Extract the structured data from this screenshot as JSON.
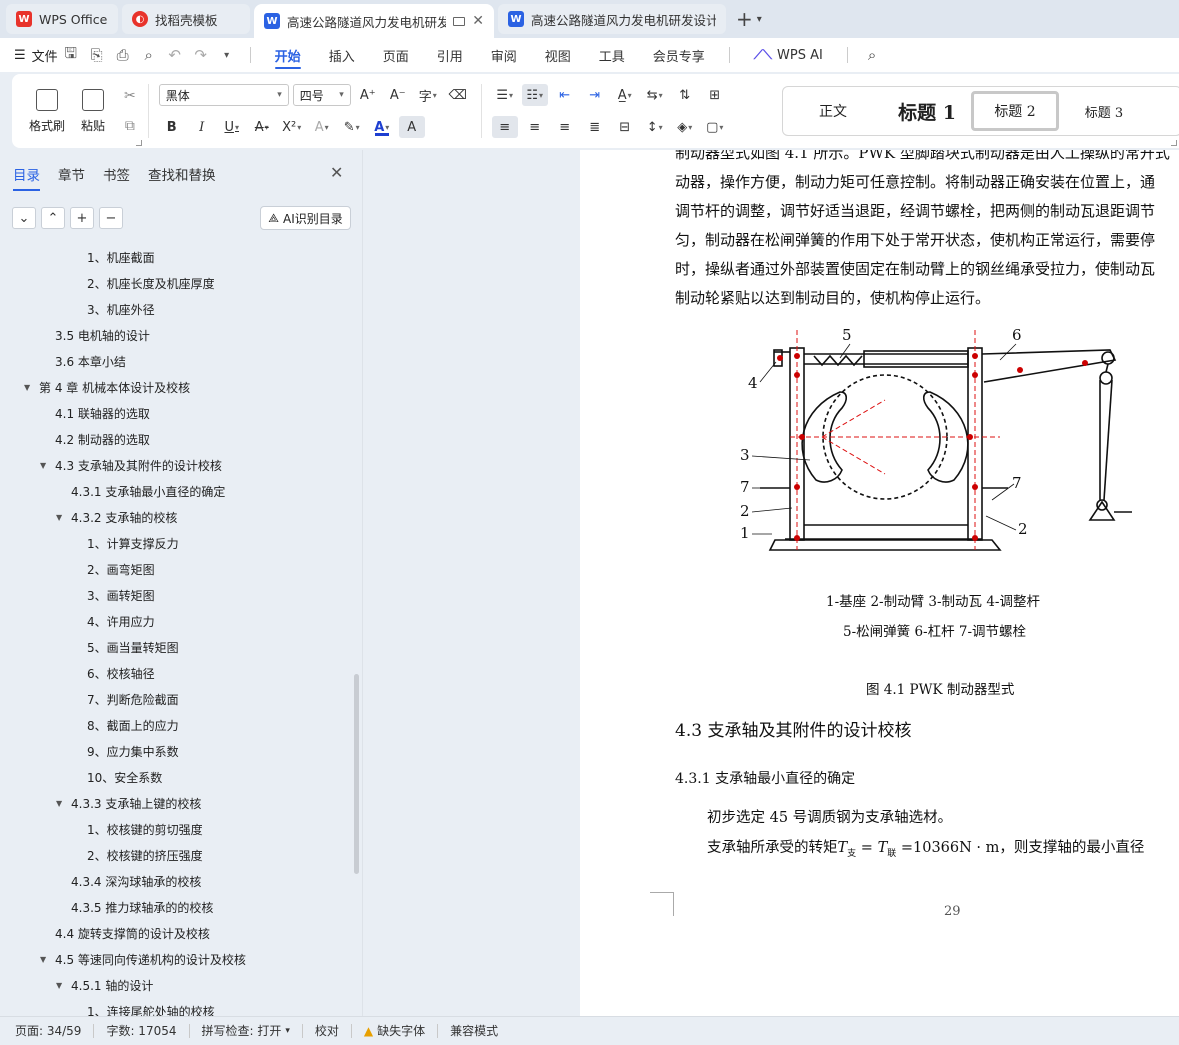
{
  "tabs": [
    {
      "label": "WPS Office",
      "icon": "wps-logo-icon",
      "state": "inactive"
    },
    {
      "label": "找稻壳模板",
      "icon": "daoke-icon",
      "state": "inactive"
    },
    {
      "label": "高速公路隧道风力发电机研发",
      "icon": "word-doc-icon",
      "state": "active"
    },
    {
      "label": "高速公路隧道风力发电机研发设计 说",
      "icon": "word-doc-icon",
      "state": "inactive"
    }
  ],
  "menu": {
    "file": "文件",
    "tabs": [
      "开始",
      "插入",
      "页面",
      "引用",
      "审阅",
      "视图",
      "工具",
      "会员专享"
    ],
    "active_tab": "开始",
    "wps_ai": "WPS AI"
  },
  "ribbon": {
    "format_painter": "格式刷",
    "paste": "粘贴",
    "font_name": "黑体",
    "font_size": "四号",
    "styles": {
      "normal": "正文",
      "h1": "标题  1",
      "h2": "标题  2",
      "h3": "标题  3"
    }
  },
  "sidebar": {
    "tabs": [
      "目录",
      "章节",
      "书签",
      "查找和替换"
    ],
    "active_tab": "目录",
    "ai_outline": "AI识别目录",
    "toc": [
      {
        "label": "1、机座截面",
        "level": 4,
        "arrow": ""
      },
      {
        "label": "2、机座长度及机座厚度",
        "level": 4,
        "arrow": ""
      },
      {
        "label": "3、机座外径",
        "level": 4,
        "arrow": ""
      },
      {
        "label": "3.5  电机轴的设计",
        "level": 2,
        "arrow": ""
      },
      {
        "label": "3.6  本章小结",
        "level": 2,
        "arrow": ""
      },
      {
        "label": "第 4 章  机械本体设计及校核",
        "level": 1,
        "arrow": "▼"
      },
      {
        "label": "4.1  联轴器的选取",
        "level": 2,
        "arrow": ""
      },
      {
        "label": "4.2  制动器的选取",
        "level": 2,
        "arrow": ""
      },
      {
        "label": "4.3  支承轴及其附件的设计校核",
        "level": 2,
        "arrow": "▼"
      },
      {
        "label": "4.3.1  支承轴最小直径的确定",
        "level": 3,
        "arrow": ""
      },
      {
        "label": "4.3.2  支承轴的校核",
        "level": 3,
        "arrow": "▼"
      },
      {
        "label": "1、计算支撑反力",
        "level": 4,
        "arrow": ""
      },
      {
        "label": "2、画弯矩图",
        "level": 4,
        "arrow": ""
      },
      {
        "label": "3、画转矩图",
        "level": 4,
        "arrow": ""
      },
      {
        "label": "4、许用应力",
        "level": 4,
        "arrow": ""
      },
      {
        "label": "5、画当量转矩图",
        "level": 4,
        "arrow": ""
      },
      {
        "label": "6、校核轴径",
        "level": 4,
        "arrow": ""
      },
      {
        "label": "7、判断危险截面",
        "level": 4,
        "arrow": ""
      },
      {
        "label": "8、截面上的应力",
        "level": 4,
        "arrow": ""
      },
      {
        "label": "9、应力集中系数",
        "level": 4,
        "arrow": ""
      },
      {
        "label": "10、安全系数",
        "level": 4,
        "arrow": ""
      },
      {
        "label": "4.3.3  支承轴上键的校核",
        "level": 3,
        "arrow": "▼"
      },
      {
        "label": "1、校核键的剪切强度",
        "level": 4,
        "arrow": ""
      },
      {
        "label": "2、校核键的挤压强度",
        "level": 4,
        "arrow": ""
      },
      {
        "label": "4.3.4  深沟球轴承的校核",
        "level": 3,
        "arrow": ""
      },
      {
        "label": "4.3.5  推力球轴承的的校核",
        "level": 3,
        "arrow": ""
      },
      {
        "label": "4.4  旋转支撑筒的设计及校核",
        "level": 2,
        "arrow": ""
      },
      {
        "label": "4.5  等速同向传递机构的设计及校核",
        "level": 2,
        "arrow": "▼"
      },
      {
        "label": "4.5.1  轴的设计",
        "level": 3,
        "arrow": "▼"
      },
      {
        "label": "1、连接尾舵处轴的校核",
        "level": 4,
        "arrow": ""
      }
    ]
  },
  "document": {
    "lines": [
      "制动器型式如图 4.1 所示。PWK 型脚踏块式制动器是由人工操纵的常开式",
      "动器，操作方便，制动力矩可任意控制。将制动器正确安装在位置上，通",
      "调节杆的调整，调节好适当退距，经调节螺栓，把两侧的制动瓦退距调节",
      "匀，制动器在松闸弹簧的作用下处于常开状态，使机构正常运行，需要停",
      "时，操纵者通过外部装置使固定在制动臂上的钢丝绳承受拉力，使制动瓦",
      "制动轮紧贴以达到制动目的，使机构停止运行。"
    ],
    "figure_labels": [
      "1",
      "2",
      "3",
      "4",
      "5",
      "6",
      "7",
      "7",
      "2"
    ],
    "legend_line1": "1-基座  2-制动臂  3-制动瓦  4-调整杆",
    "legend_line2": "5-松闸弹簧  6-杠杆  7-调节螺栓",
    "figure_caption": "图 4.1 PWK 制动器型式",
    "heading2": "4.3  支承轴及其附件的设计校核",
    "heading3": "4.3.1  支承轴最小直径的确定",
    "para1": "初步选定 45 号调质钢为支承轴选材。",
    "para2_pre": "支承轴所承受的转矩",
    "formula": {
      "t1": "T",
      "s1": "支",
      "eq": " = ",
      "t2": "T",
      "s2": "联",
      "rest": " =10366N · m"
    },
    "para2_post": "，则支撑轴的最小直径",
    "page_number": "29"
  },
  "status": {
    "page": "页面: 34/59",
    "words": "字数: 17054",
    "spell": "拼写检查: 打开",
    "proof": "校对",
    "missing_font": "缺失字体",
    "compat": "兼容模式"
  }
}
